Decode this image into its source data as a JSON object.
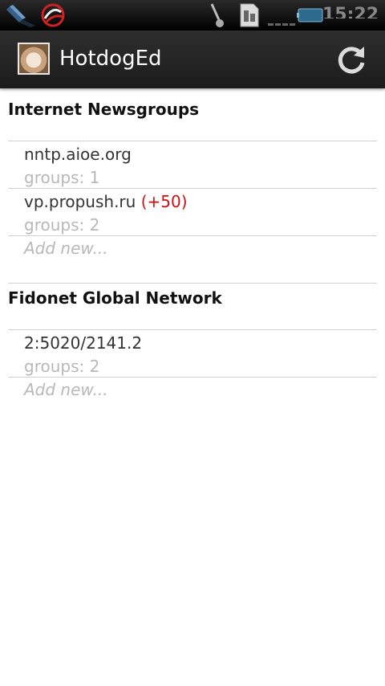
{
  "status_bar": {
    "icons": [
      "usb-icon",
      "app-notification-icon",
      "headset-icon",
      "sim-card-icon",
      "signal-icon",
      "battery-icon"
    ],
    "clock": "15:22"
  },
  "action_bar": {
    "title": "HotdogEd",
    "refresh_icon": "refresh-icon"
  },
  "sections": [
    {
      "title": "Internet Newsgroups",
      "servers": [
        {
          "name": "nntp.aioe.org",
          "unread": "",
          "groups": "groups: 1"
        },
        {
          "name": "vp.propush.ru",
          "unread": "(+50)",
          "groups": "groups: 2"
        }
      ],
      "add_label": "Add new..."
    },
    {
      "title": "Fidonet Global Network",
      "servers": [
        {
          "name": "2:5020/2141.2",
          "unread": "",
          "groups": "groups: 2"
        }
      ],
      "add_label": "Add new..."
    }
  ],
  "colors": {
    "unread": "#cc1111",
    "secondary_text": "#b8b8b8",
    "action_bar": "#1c1c1c"
  }
}
